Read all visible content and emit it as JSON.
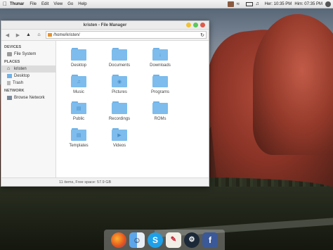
{
  "menubar": {
    "app_name": "Thunar",
    "menus": [
      "File",
      "Edit",
      "View",
      "Go",
      "Help"
    ],
    "clock1": "Her: 10:35 PM",
    "clock2": "Him: 07:35 PM"
  },
  "window": {
    "title": "kristen - File Manager",
    "location": "/home/kristen/",
    "status": "11 items, Free space: 57.9 GB"
  },
  "sidebar": {
    "devices_header": "DEVICES",
    "devices": [
      {
        "label": "File System",
        "icon": "drive-icon"
      }
    ],
    "places_header": "PLACES",
    "places": [
      {
        "label": "kristen",
        "icon": "home-icon"
      },
      {
        "label": "Desktop",
        "icon": "desktop-icon"
      },
      {
        "label": "Trash",
        "icon": "trash-icon"
      }
    ],
    "network_header": "NETWORK",
    "network": [
      {
        "label": "Browse Network",
        "icon": "network-icon"
      }
    ]
  },
  "folders": [
    {
      "label": "Desktop",
      "icon": "folder-icon"
    },
    {
      "label": "Documents",
      "icon": "folder-icon"
    },
    {
      "label": "Downloads",
      "icon": "folder-download-icon"
    },
    {
      "label": "Music",
      "icon": "folder-music-icon"
    },
    {
      "label": "Pictures",
      "icon": "folder-pictures-icon"
    },
    {
      "label": "Programs",
      "icon": "folder-icon"
    },
    {
      "label": "Public",
      "icon": "folder-public-icon"
    },
    {
      "label": "Recordings",
      "icon": "folder-icon"
    },
    {
      "label": "ROMs",
      "icon": "folder-icon"
    },
    {
      "label": "Templates",
      "icon": "folder-templates-icon"
    },
    {
      "label": "Videos",
      "icon": "folder-videos-icon"
    }
  ],
  "dock": [
    "firefox-icon",
    "finder-icon",
    "skype-icon",
    "text-editor-icon",
    "steam-icon",
    "facebook-icon"
  ],
  "colors": {
    "folder": "#7dbcec",
    "accent": "#4a8fc8"
  }
}
